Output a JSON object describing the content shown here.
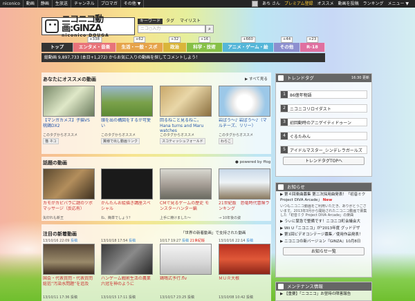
{
  "topbar": {
    "nav": [
      "niconico",
      "動画",
      "静画",
      "生放送",
      "チャンネル",
      "ブロマガ",
      "その他 ▼"
    ],
    "user": "あち さん",
    "premium": "プレミアム登録",
    "right": [
      "オススメ",
      "動画を投稿",
      "ランキング",
      "メニュー ▼"
    ]
  },
  "logo": {
    "title": "ニコニコ動画:GINZA",
    "sub": "niconico DOUGA"
  },
  "search": {
    "tabs": [
      "キーワード",
      "タグ",
      "マイリスト"
    ],
    "placeholder": "ニコ○入力"
  },
  "genres": [
    {
      "label": "トップ",
      "count": "",
      "color": "#333333"
    },
    {
      "label": "エンタメ・音楽",
      "count": "+338",
      "color": "#e8737a"
    },
    {
      "label": "生活・一般・スポ",
      "count": "+62",
      "color": "#e6a34a"
    },
    {
      "label": "政治",
      "count": "+32",
      "color": "#d9b53a"
    },
    {
      "label": "科学・技術",
      "count": "+16",
      "color": "#86c046"
    },
    {
      "label": "アニメ・ゲーム・絵",
      "count": "+660",
      "color": "#55b6d8"
    },
    {
      "label": "その他",
      "count": "+44",
      "color": "#8d8fcf"
    },
    {
      "label": "R-18",
      "count": "+23",
      "color": "#e070a0"
    }
  ],
  "statbar": "総動画 9,897,733 (本日+1,272) からお気に入りの動画を探してコメントしよう！",
  "recommend": {
    "heading": "あなたにオススメの動画",
    "more": "▶ すべて見る",
    "items": [
      {
        "title": "【マンガカメズ】子猫VS 桃鶏DX2",
        "note": "このタグからオススメ",
        "tag": "猫 ネコ"
      },
      {
        "title": "頭を出の構図をするが可愛い",
        "note": "このタグからオススメ",
        "tag": "翼様で出し動画リンク"
      },
      {
        "title": "回るねこと見るねこ。 Hana turns and Maru watches",
        "note": "このタグからオススメ",
        "tag": "スコティッシュフォールド"
      },
      {
        "title": "岩ぱう～♪ 岩ぱう～♪（マルチーズ、リリー）",
        "note": "このタグからオススメ",
        "tag": "わらこ"
      }
    ]
  },
  "topic": {
    "heading": "話題の動画",
    "more": "● powered by ffog",
    "items": [
      {
        "title": "カモがカピバラに謎のツボマッサージ（反応有）",
        "note": "矢印れも新王"
      },
      {
        "title": "かんたんお絵描き講座スペシャル",
        "note": "ね、簡単でしょう？"
      },
      {
        "title": "CMで見るゲームの歴史 モンスターハンター編",
        "note": "上手に焼けました～"
      },
      {
        "title": "21世紀版　恐竜時代冒険ランキング",
        "note": "→ 10年後の姿"
      }
    ]
  },
  "newvideos": {
    "heading": "注目の新着動画",
    "more": "「世界の新着動画」で支持された動画",
    "items": [
      {
        "time": "13/10/16 22:09",
        "tag": "投稿",
        "title": "国会・代表質問・代表質問総括”汚染水問題”を追及"
      },
      {
        "time": "13/10/18 17:54",
        "tag": "投稿",
        "title": "ハンゲーム戦術生活の農業六冠を神のように"
      },
      {
        "time": "10/17 19:27",
        "tag": "投稿",
        "extra": "21世紀版",
        "title": "鶏鳴式予行.flv"
      },
      {
        "time": "13/10/16 22:14",
        "tag": "投稿",
        "title": "ＭＵＲ大根"
      }
    ],
    "row2": [
      "13/10/11 17:36 投稿",
      "13/10/15 17:11 投稿",
      "13/10/17 23:25 投稿",
      "13/10/08 10:42 投稿"
    ]
  },
  "trend": {
    "heading": "トレンドタグ",
    "time": "16:30 更新",
    "items": [
      "86億年物語",
      "ニコニコリロイダスト",
      "初回動時のアニゲイティドゥーン",
      "ぐるたみん",
      "アイドルマスター_シンデレラガールズ"
    ],
    "button": "トレンドタグTOPへ"
  },
  "notice": {
    "heading": "お知らせ",
    "items": [
      {
        "text": "第４回楽曲募集 第二次採用曲発表！「初音ミク Project DIVA Arcade」",
        "new": "New"
      },
      {
        "text": "いつもニコニコ動画をご利用いただき、ありがとうございます。2013年3月から開始されたニコニコ動画で募集した「初音ミク Project DIVA Arcade」の楽曲",
        "new": ""
      },
      {
        "text": "うぃに緊急で整備です！ニコニコ町会議会大",
        "new": ""
      },
      {
        "text": "Wii U「ニコニコ」が\"2013年度 グッドデザ",
        "new": ""
      },
      {
        "text": "第1回ビデオコンテージ募集／使用作品発表！",
        "new": ""
      },
      {
        "text": "ニコニコの新バージョン『GINZA』10月8日",
        "new": ""
      }
    ],
    "button": "お知らせ一覧"
  },
  "maint": {
    "heading": "メンテナンス情報",
    "item": "【重要】「ニコニコ」お昼時の障害報告"
  }
}
